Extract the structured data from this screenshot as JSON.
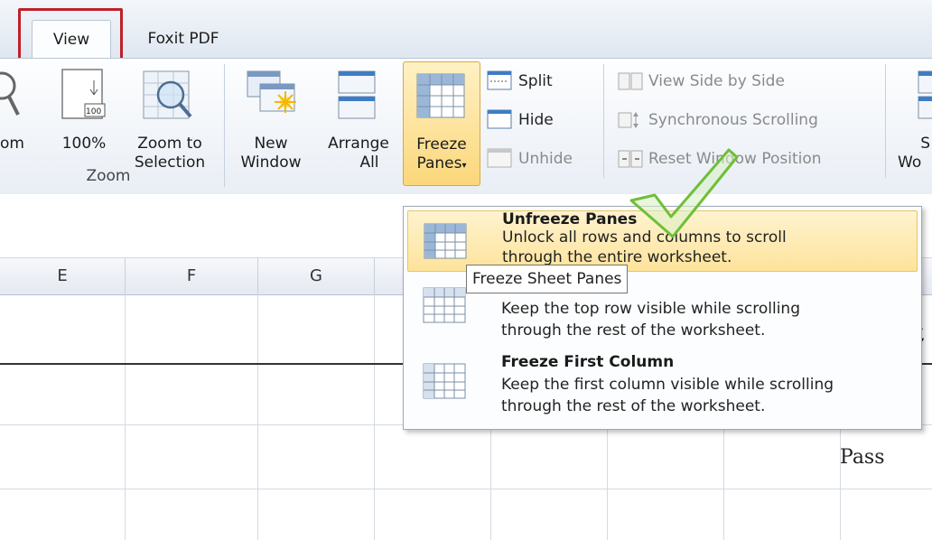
{
  "tabs": {
    "view": "View",
    "foxit": "Foxit PDF"
  },
  "ribbon": {
    "zoom_partial": "om",
    "zoom100": "100%",
    "zoom_to_selection": [
      "Zoom to",
      "Selection"
    ],
    "zoom_group": "Zoom",
    "new_window": [
      "New",
      "Window"
    ],
    "arrange_all": [
      "Arrange",
      "All"
    ],
    "freeze_panes": [
      "Freeze",
      "Panes"
    ],
    "split": "Split",
    "hide": "Hide",
    "unhide": "Unhide",
    "view_side_by_side": "View Side by Side",
    "synchronous_scrolling": "Synchronous Scrolling",
    "reset_window_position": "Reset Window Position",
    "save_workspace_partial": [
      "S",
      "Wo"
    ]
  },
  "columns": [
    "E",
    "F",
    "G"
  ],
  "menu": {
    "unfreeze": {
      "title": "Unfreeze Panes",
      "desc": [
        "Unlock all rows and columns to scroll",
        "through the entire worksheet."
      ]
    },
    "freeze_top_row": {
      "desc": [
        "Keep the top row visible while scrolling",
        "through the rest of the worksheet."
      ]
    },
    "freeze_first_column": {
      "title": "Freeze First Column",
      "desc": [
        "Keep the first column visible while scrolling",
        "through the rest of the worksheet."
      ]
    }
  },
  "tooltip": "Freeze Sheet Panes",
  "cells": {
    "pass": "Pass",
    "partial_t": "t"
  },
  "colors": {
    "highlight_red": "#c0202a",
    "menu_hover": "#fde39b",
    "check_green": "#6fbf3a"
  }
}
